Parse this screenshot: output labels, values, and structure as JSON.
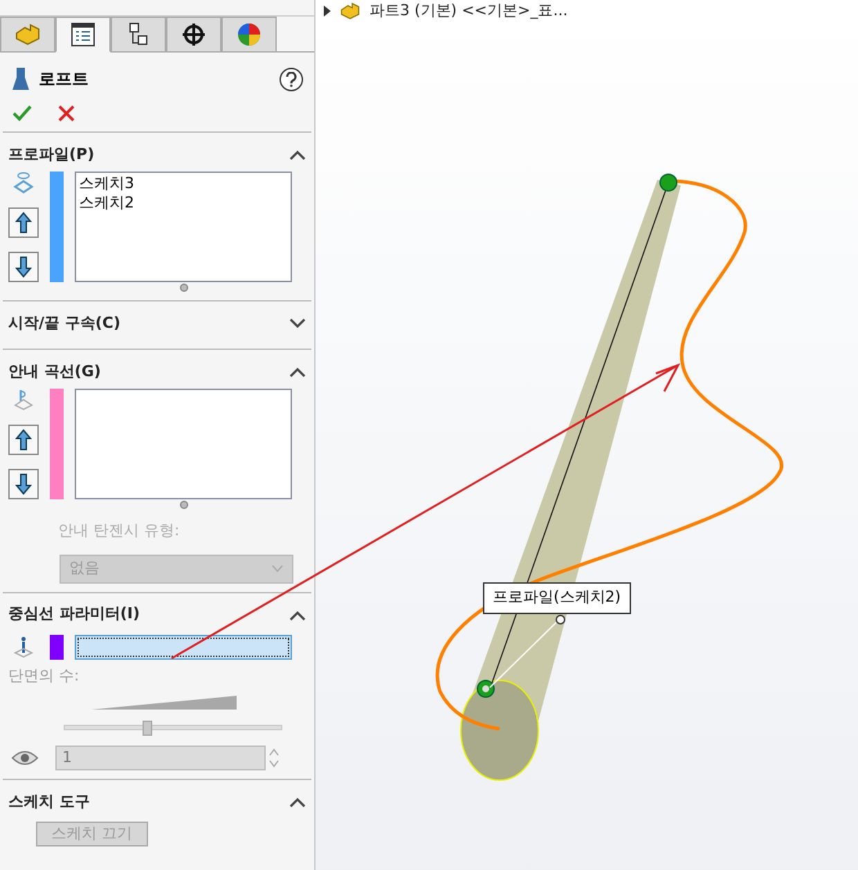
{
  "tabs": [
    {
      "selected": false
    },
    {
      "selected": true
    },
    {
      "selected": false
    },
    {
      "selected": false
    },
    {
      "selected": false
    }
  ],
  "feature": {
    "title": "로프트"
  },
  "profiles": {
    "title": "프로파일(P)",
    "expanded": true,
    "color": "#4aa3ff",
    "items": [
      "스케치3",
      "스케치2"
    ]
  },
  "start_end": {
    "title": "시작/끝 구속(C)",
    "expanded": false
  },
  "guides": {
    "title": "안내 곡선(G)",
    "expanded": true,
    "color": "#ff80c0",
    "tangent_label": "안내 탄젠시 유형:",
    "tangent_value": "없음",
    "disabled": true
  },
  "centerline": {
    "title": "중심선 파라미터(I)",
    "expanded": true,
    "color": "#8000ff",
    "sections_label": "단면의 수:",
    "level": 0.38,
    "count": "1"
  },
  "sketch_tools": {
    "title": "스케치 도구",
    "expanded": true,
    "button": "스케치 끄기"
  },
  "tree": {
    "label": "파트3 (기본) <<기본>_표..."
  },
  "callout": {
    "label": "프로파일(스케치2)"
  }
}
